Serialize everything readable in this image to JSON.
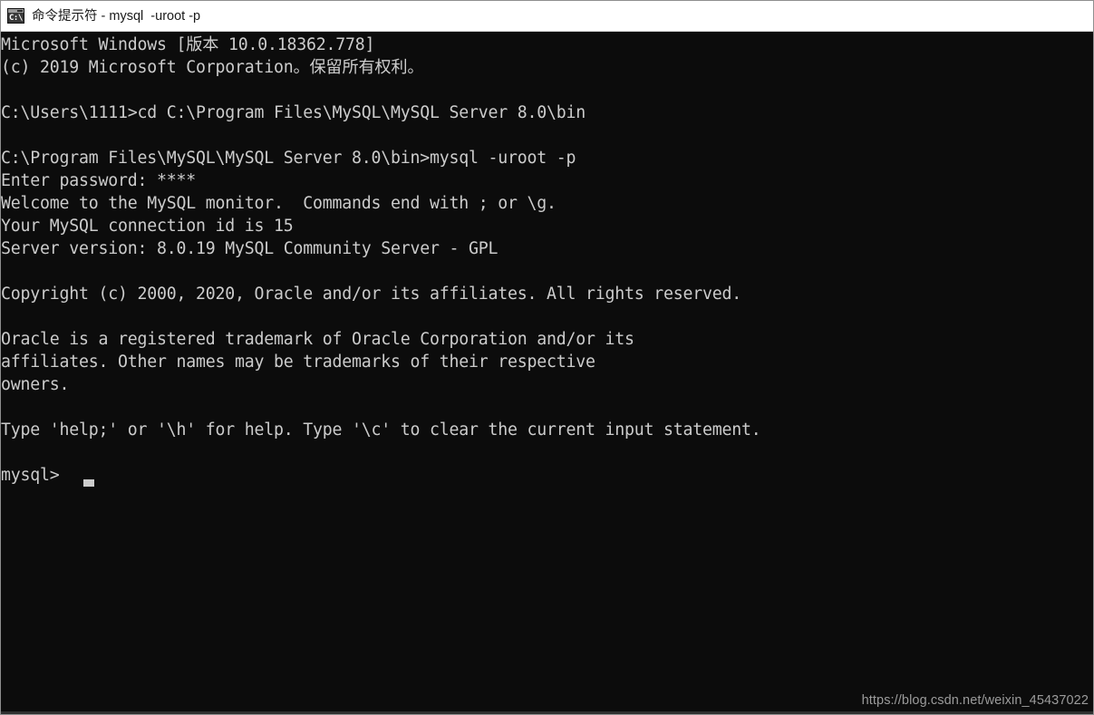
{
  "window": {
    "title": "命令提示符 - mysql  -uroot -p",
    "icon": "cmd-console-icon",
    "icon_glyph": "C:\\.",
    "titlebar_background": "#ffffff",
    "console_background": "#0c0c0c",
    "console_foreground": "#cccccc"
  },
  "console": {
    "lines": [
      "Microsoft Windows [版本 10.0.18362.778]",
      "(c) 2019 Microsoft Corporation。保留所有权利。",
      "",
      "C:\\Users\\1111>cd C:\\Program Files\\MySQL\\MySQL Server 8.0\\bin",
      "",
      "C:\\Program Files\\MySQL\\MySQL Server 8.0\\bin>mysql -uroot -p",
      "Enter password: ****",
      "Welcome to the MySQL monitor.  Commands end with ; or \\g.",
      "Your MySQL connection id is 15",
      "Server version: 8.0.19 MySQL Community Server - GPL",
      "",
      "Copyright (c) 2000, 2020, Oracle and/or its affiliates. All rights reserved.",
      "",
      "Oracle is a registered trademark of Oracle Corporation and/or its",
      "affiliates. Other names may be trademarks of their respective",
      "owners.",
      "",
      "Type 'help;' or '\\h' for help. Type '\\c' to clear the current input statement.",
      "",
      "mysql> "
    ],
    "prompt": "mysql>",
    "cursor_visible": true
  },
  "details": {
    "os_name": "Microsoft Windows",
    "os_version_label": "版本",
    "os_version": "10.0.18362.778",
    "copyright_year": "2019",
    "copyright_owner": "Microsoft Corporation",
    "rights_text": "保留所有权利。",
    "user_directory": "C:\\Users\\1111",
    "cd_command": "cd C:\\Program Files\\MySQL\\MySQL Server 8.0\\bin",
    "mysql_directory": "C:\\Program Files\\MySQL\\MySQL Server 8.0\\bin",
    "mysql_command": "mysql -uroot -p",
    "password_prompt": "Enter password:",
    "password_masked": "****",
    "connection_id": "15",
    "server_version": "8.0.19",
    "server_edition": "MySQL Community Server - GPL",
    "oracle_copyright_years": "2000, 2020"
  },
  "watermark": {
    "url": "https://blog.csdn.net/weixin_45437022"
  }
}
